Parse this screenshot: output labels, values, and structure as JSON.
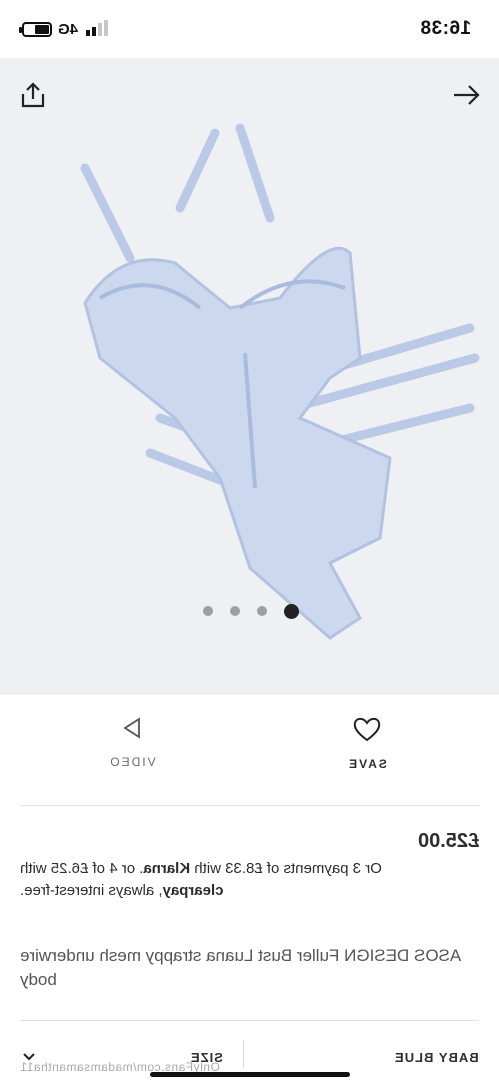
{
  "status_bar": {
    "time": "16:38",
    "network": "4G"
  },
  "gallery": {
    "page_count": 4,
    "active_index": 3
  },
  "actions": {
    "save_label": "SAVE",
    "video_label": "VIDEO"
  },
  "product": {
    "price": "£25.00",
    "payment_line_1": "Or 3 payments of £8.33 with",
    "klarna": "Klarna",
    "payment_line_1b": ". or 4 of £6.25 with",
    "clearpay": "clearpay",
    "payment_line_2": ", always interest-free.",
    "title": "ASOS DESIGN Fuller Bust Luana strappy mesh underwire body"
  },
  "options": {
    "colour": "BABY BLUE",
    "size_label": "SIZE"
  },
  "watermark": "OnlyFans.com/madamsamantha11",
  "colors": {
    "accent": "#2d2d2d",
    "image_bg": "#eef0f4",
    "garment": "#b9c9e6"
  },
  "icons": [
    "share-icon",
    "arrow-right-icon",
    "play-icon",
    "heart-icon",
    "chevron-down-icon"
  ]
}
